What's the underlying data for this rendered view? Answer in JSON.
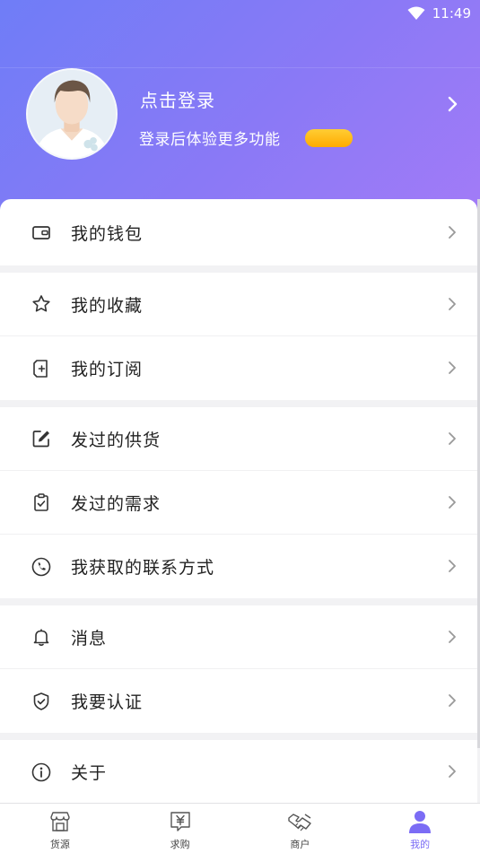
{
  "status_bar": {
    "time": "11:49"
  },
  "profile": {
    "login_title": "点击登录",
    "login_subtitle": "登录后体验更多功能"
  },
  "menu_sections": [
    [
      {
        "label": "我的钱包",
        "icon": "wallet-icon"
      }
    ],
    [
      {
        "label": "我的收藏",
        "icon": "star-icon"
      },
      {
        "label": "我的订阅",
        "icon": "subscribe-icon"
      }
    ],
    [
      {
        "label": "发过的供货",
        "icon": "edit-icon"
      },
      {
        "label": "发过的需求",
        "icon": "clipboard-icon"
      },
      {
        "label": "我获取的联系方式",
        "icon": "phone-icon"
      }
    ],
    [
      {
        "label": "消息",
        "icon": "bell-icon"
      },
      {
        "label": "我要认证",
        "icon": "shield-icon"
      }
    ],
    [
      {
        "label": "关于",
        "icon": "info-icon"
      }
    ]
  ],
  "bottom_nav": [
    {
      "label": "货源",
      "icon": "shop-icon",
      "active": false
    },
    {
      "label": "求购",
      "icon": "yuan-chat-icon",
      "active": false
    },
    {
      "label": "商户",
      "icon": "handshake-icon",
      "active": false
    },
    {
      "label": "我的",
      "icon": "person-icon",
      "active": true
    }
  ],
  "colors": {
    "accent": "#7b6cf5",
    "header_gradient_start": "#6f7df7",
    "header_gradient_end": "#a27bf7",
    "vip_pill": "#ffb400"
  }
}
